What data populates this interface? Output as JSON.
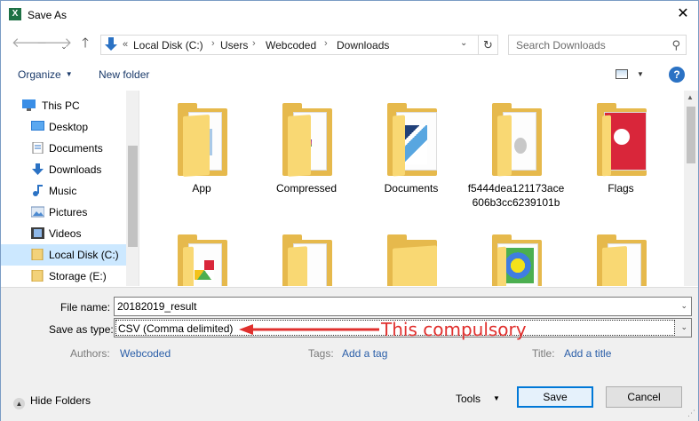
{
  "window": {
    "title": "Save As",
    "app_icon": "excel-icon",
    "close": "✕"
  },
  "nav": {
    "back": "🡐",
    "forward": "🡒",
    "recent": "⌄",
    "up": "🡑",
    "overflow": "«",
    "breadcrumbs": [
      "Local Disk (C:)",
      "Users",
      "Webcoded",
      "Downloads"
    ],
    "refresh": "↻",
    "search_placeholder": "Search Downloads"
  },
  "toolbar": {
    "organize": "Organize",
    "new_folder": "New folder",
    "help": "?"
  },
  "sidebar": {
    "items": [
      {
        "label": "This PC",
        "icon": "computer-icon"
      },
      {
        "label": "Desktop",
        "icon": "desktop-icon"
      },
      {
        "label": "Documents",
        "icon": "documents-icon"
      },
      {
        "label": "Downloads",
        "icon": "downloads-icon"
      },
      {
        "label": "Music",
        "icon": "music-icon"
      },
      {
        "label": "Pictures",
        "icon": "pictures-icon"
      },
      {
        "label": "Videos",
        "icon": "videos-icon"
      },
      {
        "label": "Local Disk (C:)",
        "icon": "drive-icon",
        "selected": true
      },
      {
        "label": "Storage (E:)",
        "icon": "drive-icon"
      }
    ]
  },
  "files": {
    "items": [
      {
        "name": "App"
      },
      {
        "name": "Compressed"
      },
      {
        "name": "Documents"
      },
      {
        "name": "f5444dea121173ace606b3cc6239101b"
      },
      {
        "name": "Flags"
      },
      {
        "name": ""
      },
      {
        "name": ""
      },
      {
        "name": ""
      },
      {
        "name": ""
      },
      {
        "name": ""
      }
    ]
  },
  "form": {
    "file_name_label": "File name:",
    "file_name_value": "20182019_result",
    "save_type_label": "Save as type:",
    "save_type_value": "CSV (Comma delimited)",
    "authors_label": "Authors:",
    "authors_value": "Webcoded",
    "tags_label": "Tags:",
    "tags_value": "Add a tag",
    "title_label": "Title:",
    "title_value": "Add a title",
    "annotation": "This compulsory",
    "annotation_color": "#e0302e"
  },
  "footer": {
    "hide_folders": "Hide Folders",
    "tools": "Tools",
    "save": "Save",
    "cancel": "Cancel"
  }
}
